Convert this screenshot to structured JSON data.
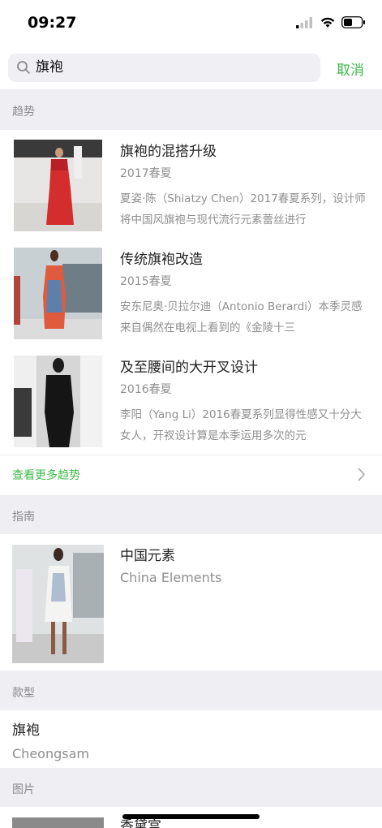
{
  "status_bar": {
    "time": "09:27"
  },
  "search": {
    "query": "旗袍",
    "cancel_label": "取消"
  },
  "sections": {
    "trends": "趋势",
    "guide": "指南",
    "style": "款型",
    "images": "图片"
  },
  "trends": [
    {
      "title": "旗袍的混搭升级",
      "season": "2017春夏",
      "desc": "夏姿·陈（Shiatzy Chen）2017春夏系列，设计师将中国风旗袍与现代流行元素蕾丝进行"
    },
    {
      "title": "传统旗袍改造",
      "season": "2015春夏",
      "desc": "安东尼奥·贝拉尔迪（Antonio Berardi）本季灵感来自偶然在电视上看到的《金陵十三"
    },
    {
      "title": "及至腰间的大开叉设计",
      "season": "2016春夏",
      "desc": "李阳（Yang Li）2016春夏系列显得性感又十分大女人，开衩设计算是本季运用多次的元"
    }
  ],
  "more_trends_label": "查看更多趋势",
  "guide_item": {
    "title": "中国元素",
    "subtitle": "China Elements"
  },
  "style_item": {
    "title": "旗袍",
    "subtitle": "Cheongsam"
  },
  "image_item": {
    "title": "香黛宫"
  },
  "colors": {
    "accent": "#3fba4a",
    "section_bg": "#eeeef3",
    "secondary_text": "#8f8f8f"
  }
}
